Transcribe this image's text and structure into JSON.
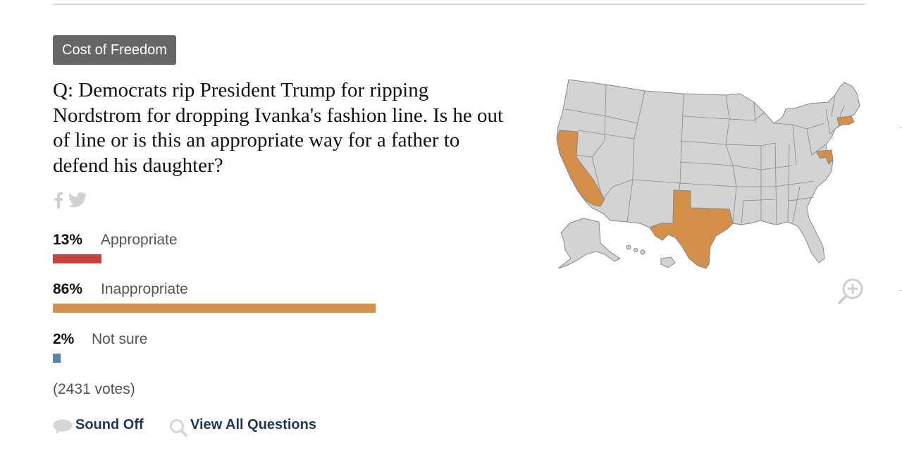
{
  "category_tag": "Cost of Freedom",
  "question": "Q: Democrats rip President Trump for ripping Nordstrom for dropping Ivanka's fashion line. Is he out of line or is this an appropriate way for a father to defend his daughter?",
  "share_icons": [
    "facebook-icon",
    "twitter-icon"
  ],
  "results": [
    {
      "percent": "13%",
      "label": "Appropriate",
      "value": 13,
      "color": "#c9413e"
    },
    {
      "percent": "86%",
      "label": "Inappropriate",
      "value": 86,
      "color": "#d4904a"
    },
    {
      "percent": "2%",
      "label": "Not sure",
      "value": 2,
      "color": "#5b85a8"
    }
  ],
  "votes": "(2431 votes)",
  "links": {
    "sound_off": "Sound Off",
    "view_all": "View All Questions"
  },
  "map": {
    "highlight_color": "#d4904a",
    "base_color": "#d3d3d3",
    "highlighted_states": [
      "California",
      "Texas",
      "Maryland",
      "Massachusetts"
    ]
  },
  "icons": {
    "sound_off": "speech-bubble-icon",
    "view_all": "magnifier-icon",
    "zoom": "zoom-in-icon"
  }
}
